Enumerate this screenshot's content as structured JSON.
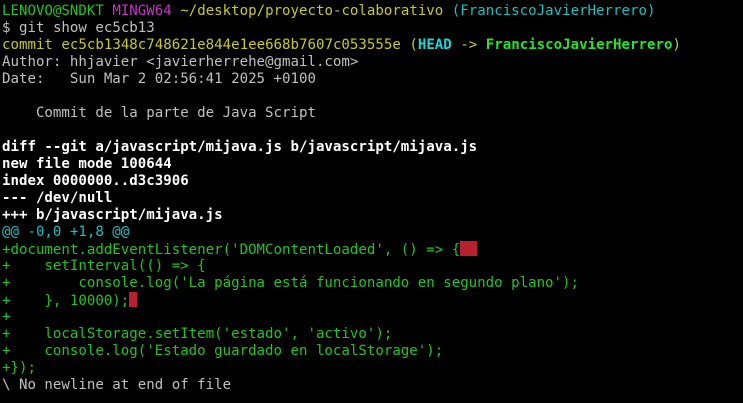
{
  "prompt": {
    "user_host": "LENOVO@SNDKT",
    "shell": "MINGW64",
    "cwd": "~/desktop/proyecto-colaborativo",
    "branch": "(FranciscoJavierHerrero)",
    "symbol": "$",
    "command": "git show ec5cb13"
  },
  "commit": {
    "label": "commit",
    "hash": "ec5cb1348c748621e844e1ee668b7607c053555e",
    "ref_open": "(",
    "head": "HEAD",
    "arrow": "->",
    "branch": "FranciscoJavierHerrero",
    "ref_close": ")",
    "author_line": "Author: hhjavier <javierherrehe@gmail.com>",
    "date_line": "Date:   Sun Mar 2 02:56:41 2025 +0100",
    "message": "    Commit de la parte de Java Script"
  },
  "diff_header": [
    "diff --git a/javascript/mijava.js b/javascript/mijava.js",
    "new file mode 100644",
    "index 0000000..d3c3906",
    "--- /dev/null",
    "+++ b/javascript/mijava.js"
  ],
  "hunk": "@@ -0,0 +1,8 @@",
  "added_lines": [
    "+document.addEventListener('DOMContentLoaded', () => {",
    "+    setInterval(() => {",
    "+        console.log('La página está funcionando en segundo plano');",
    "+    }, 10000);",
    "+",
    "+    localStorage.setItem('estado', 'activo');",
    "+    console.log('Estado guardado en localStorage');",
    "+});"
  ],
  "no_newline": "\\ No newline at end of file",
  "colors": {
    "background": "#000000",
    "prompt_green": "#23c323",
    "shell_magenta": "#c832c8",
    "path_yellow": "#c8c828",
    "branch_cyan": "#1dbfc0",
    "whitespace_error": "#b8212e"
  }
}
